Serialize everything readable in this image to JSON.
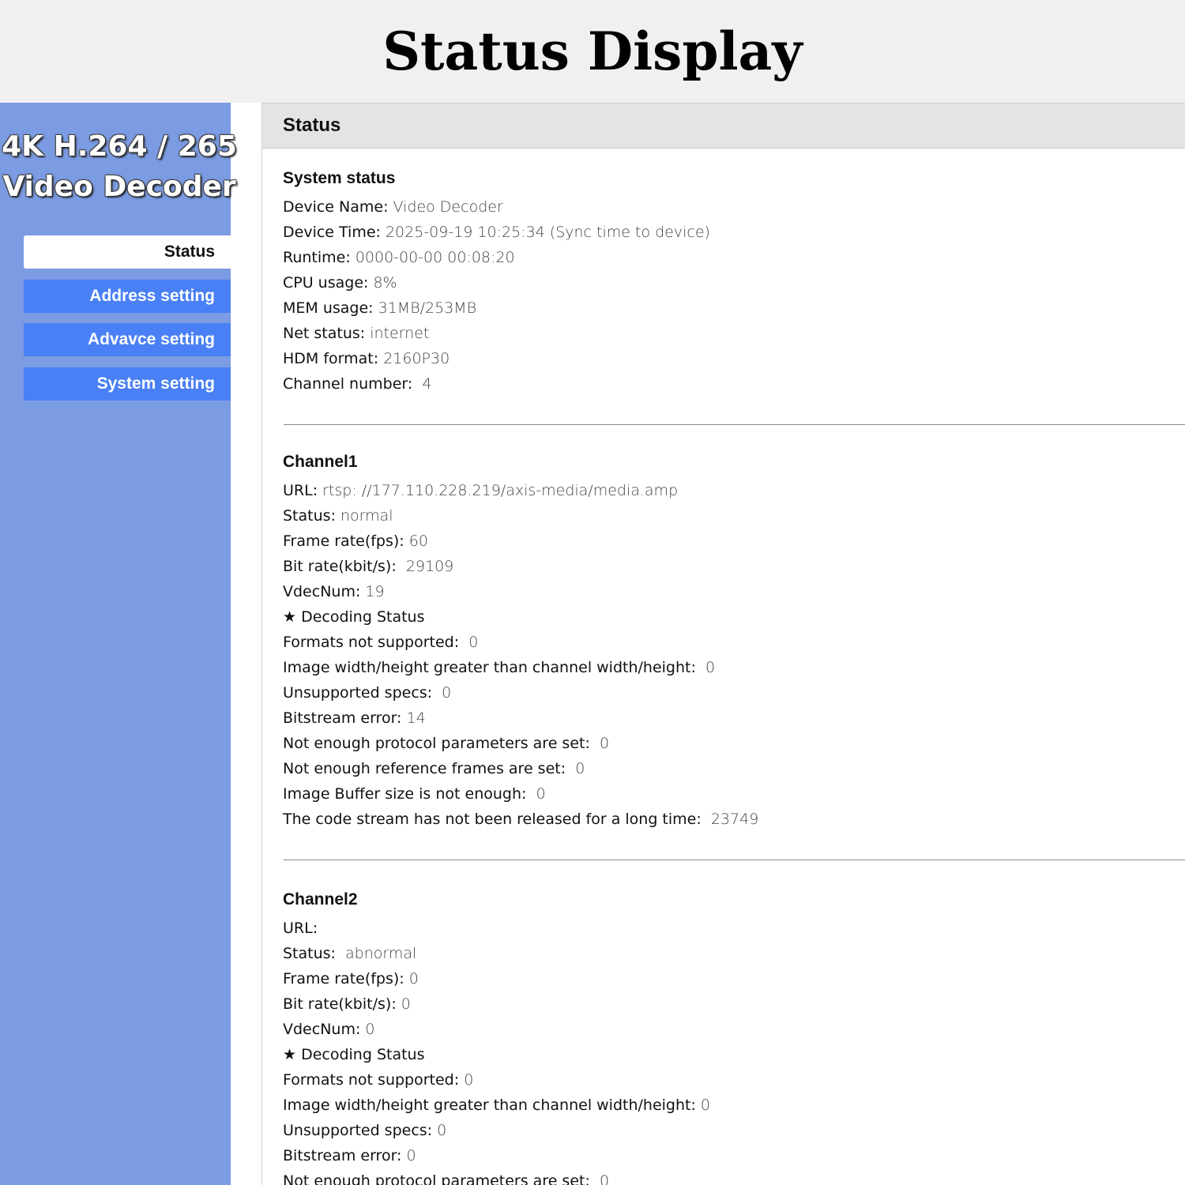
{
  "header": {
    "title": "Status Display"
  },
  "sidebar": {
    "brand_line1": "4K H.264 / 265",
    "brand_line2": "Video Decoder",
    "items": [
      {
        "label": "Status"
      },
      {
        "label": "Address setting"
      },
      {
        "label": "Advavce setting"
      },
      {
        "label": "System setting"
      }
    ]
  },
  "panel": {
    "title": "Status"
  },
  "system": {
    "heading": "System status",
    "rows": [
      {
        "key": "Device Name:",
        "value": " Video Decoder"
      },
      {
        "key": "Device Time:",
        "value": " 2025-09-19 10:25:34 (Sync time to device)"
      },
      {
        "key": "Runtime:",
        "value": " 0000-00-00 00:08:20"
      },
      {
        "key": "CPU usage:",
        "value": " 8%"
      },
      {
        "key": "MEM usage:",
        "value": " 31MB/253MB"
      },
      {
        "key": "Net status:",
        "value": " internet"
      },
      {
        "key": "HDM format:",
        "value": " 2160P30"
      },
      {
        "key": "Channel number:",
        "value": "  4"
      }
    ]
  },
  "channel1": {
    "heading": "Channel1",
    "rows": [
      {
        "key": "URL:",
        "value": " rtsp: //177.110.228.219/axis-media/media.amp"
      },
      {
        "key": "Status:",
        "value": " normal"
      },
      {
        "key": "Frame rate(fps):",
        "value": " 60"
      },
      {
        "key": "Bit rate(kbit/s):",
        "value": "  29109"
      },
      {
        "key": "VdecNum:",
        "value": " 19"
      },
      {
        "key": "★ Decoding Status",
        "value": ""
      },
      {
        "key": "Formats not supported:",
        "value": "  0"
      },
      {
        "key": "Image width/height greater than channel width/height:",
        "value": "  0"
      },
      {
        "key": "Unsupported specs:",
        "value": "  0"
      },
      {
        "key": "Bitstream error:",
        "value": " 14"
      },
      {
        "key": "Not enough protocol parameters are set:",
        "value": "  0"
      },
      {
        "key": "Not enough reference frames are set:",
        "value": "  0"
      },
      {
        "key": "Image Buffer size is not enough:",
        "value": "  0"
      },
      {
        "key": "The code stream has not been released for a long time:",
        "value": "  23749"
      }
    ]
  },
  "channel2": {
    "heading": "Channel2",
    "rows": [
      {
        "key": "URL:",
        "value": ""
      },
      {
        "key": "Status:",
        "value": "  abnormal"
      },
      {
        "key": "Frame rate(fps):",
        "value": " 0"
      },
      {
        "key": "Bit rate(kbit/s):",
        "value": " 0"
      },
      {
        "key": "VdecNum:",
        "value": " 0"
      },
      {
        "key": "★ Decoding Status",
        "value": ""
      },
      {
        "key": "Formats not supported:",
        "value": " 0"
      },
      {
        "key": "Image width/height greater than channel width/height:",
        "value": " 0"
      },
      {
        "key": "Unsupported specs:",
        "value": " 0"
      },
      {
        "key": "Bitstream error:",
        "value": " 0"
      },
      {
        "key": "Not enough protocol parameters are set:",
        "value": "  0"
      }
    ]
  }
}
